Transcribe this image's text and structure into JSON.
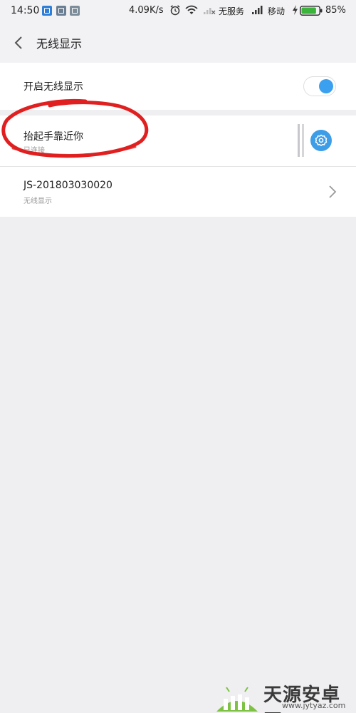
{
  "status_bar": {
    "time": "14:50",
    "network_speed": "4.09K/s",
    "carrier_1": "无服务",
    "carrier_2": "移动",
    "battery_percent": "85%",
    "battery_level": 0.85,
    "notification_icons": [
      "app-notification-icon",
      "photo-notification-icon",
      "message-notification-icon"
    ]
  },
  "header": {
    "back_icon": "chevron-left-icon",
    "title": "无线显示"
  },
  "settings": {
    "enable_label": "开启无线显示",
    "enabled": true,
    "accent_color": "#3aa0ef"
  },
  "devices": [
    {
      "name": "抬起手靠近你",
      "status": "已连接",
      "action_icon": "settings-gear-icon"
    },
    {
      "name": "JS-201803030020",
      "status": "无线显示",
      "action_icon": "chevron-right-icon"
    }
  ],
  "annotation": {
    "color": "#e02020"
  },
  "watermark": {
    "name": "天源安卓网",
    "url": "www.jytyaz.com"
  }
}
